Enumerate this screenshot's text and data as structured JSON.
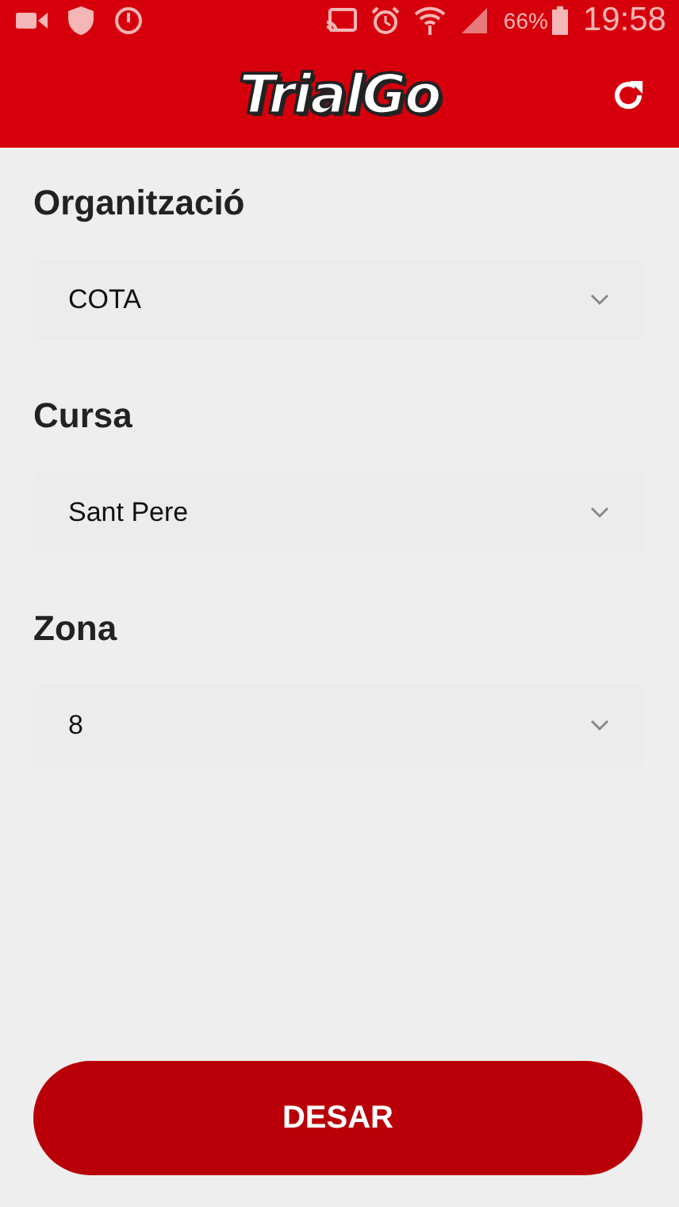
{
  "status_bar": {
    "battery": "66%",
    "time": "19:58"
  },
  "app_bar": {
    "title": "TrialGo"
  },
  "fields": [
    {
      "label": "Organització",
      "value": "COTA"
    },
    {
      "label": "Cursa",
      "value": "Sant Pere"
    },
    {
      "label": "Zona",
      "value": "8"
    }
  ],
  "button": "DESAR"
}
